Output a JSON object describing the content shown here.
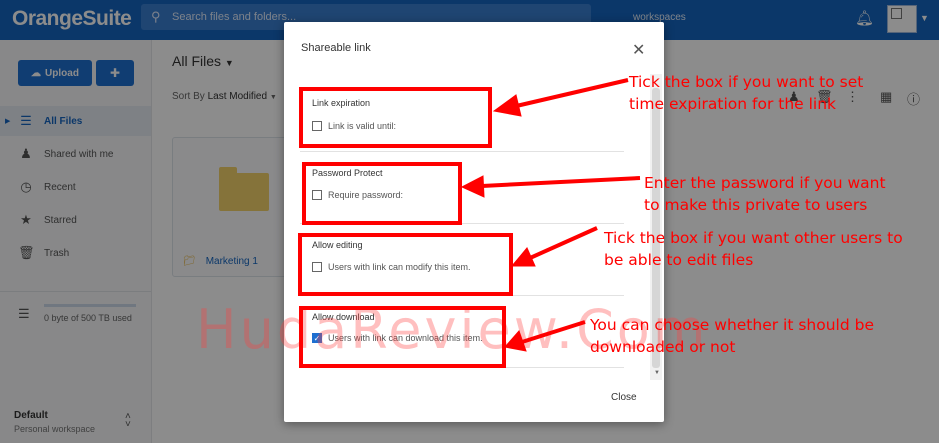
{
  "app": {
    "logo": "OrangeSuite",
    "search_placeholder": "Search files and folders...",
    "workspace_label": "workspaces"
  },
  "sidebar": {
    "upload_label": "Upload",
    "items": [
      {
        "label": "All Files",
        "icon": "all-files-icon",
        "active": true
      },
      {
        "label": "Shared with me",
        "icon": "shared-icon",
        "active": false
      },
      {
        "label": "Recent",
        "icon": "clock-icon",
        "active": false
      },
      {
        "label": "Starred",
        "icon": "star-icon",
        "active": false
      },
      {
        "label": "Trash",
        "icon": "trash-icon",
        "active": false
      }
    ],
    "storage_text": "0 byte of 500 TB used",
    "workspace_name": "Default",
    "workspace_sub": "Personal workspace"
  },
  "main": {
    "title": "All Files",
    "sort_prefix": "Sort By",
    "sort_value": "Last Modified",
    "folders": [
      {
        "name": "Marketing 1"
      }
    ]
  },
  "dialog": {
    "title": "Shareable link",
    "close_label": "Close",
    "options": [
      {
        "heading": "Link expiration",
        "checkbox_label": "Link is valid until:",
        "checked": false
      },
      {
        "heading": "Password Protect",
        "checkbox_label": "Require password:",
        "checked": false
      },
      {
        "heading": "Allow editing",
        "checkbox_label": "Users with link can modify this item.",
        "checked": false
      },
      {
        "heading": "Allow download",
        "checkbox_label": "Users with link can download this item.",
        "checked": true
      }
    ]
  },
  "annotations": [
    {
      "line1": "Tick the box if you want to set",
      "line2": "time expiration for the link"
    },
    {
      "line1": "Enter the password if you want",
      "line2": "to make this private to users"
    },
    {
      "line1": "Tick the box if you want other users to",
      "line2": "be able to edit files"
    },
    {
      "line1": "You can choose whether it should be",
      "line2": "downloaded or not"
    }
  ],
  "watermark": "HudaReview.Com",
  "colors": {
    "topbar": "#1565c0",
    "accent": "#1e6fd0",
    "annotation": "#ff0000"
  }
}
